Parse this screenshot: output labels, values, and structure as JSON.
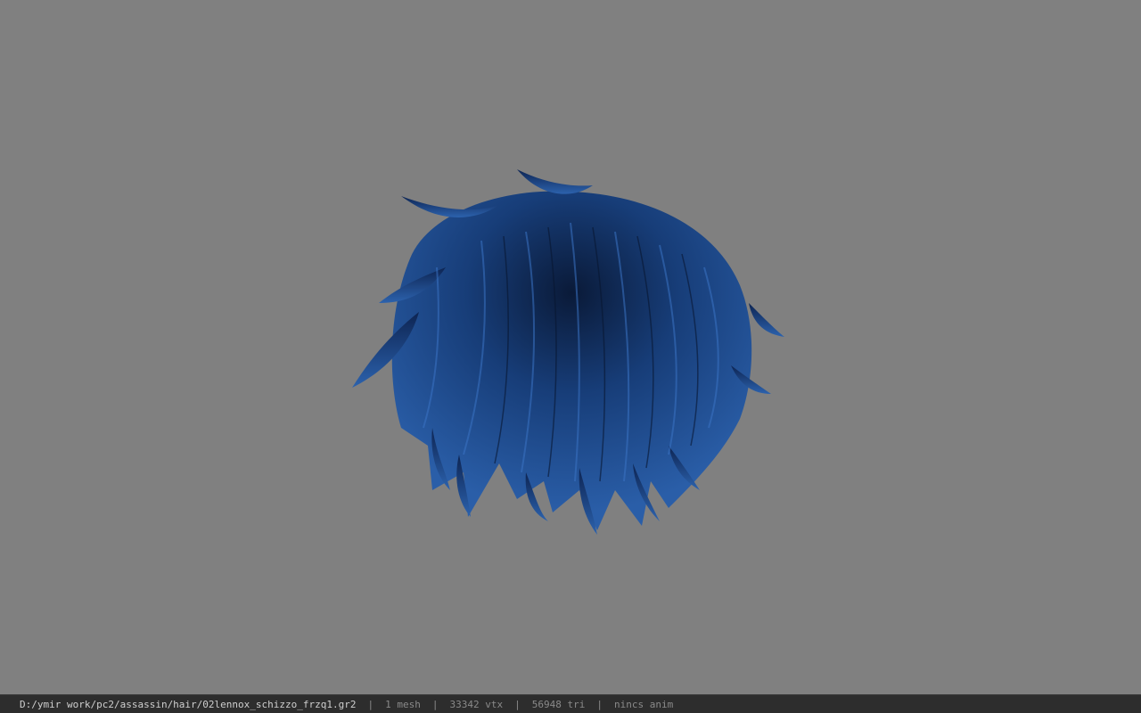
{
  "colors": {
    "background": "#808080",
    "hair": "#1f4f94",
    "hair_dark": "#0a1a38",
    "statusbar": "#2d2d2d"
  },
  "model": {
    "subject": "hair-mesh"
  },
  "statusbar": {
    "path": "D:/ymir work/pc2/assassin/hair/02lennox_schizzo_frzq1.gr2",
    "separator": "|",
    "mesh": "1 mesh",
    "vertices": "33342 vtx",
    "triangles": "56948 tri",
    "anim": "nincs anim"
  }
}
